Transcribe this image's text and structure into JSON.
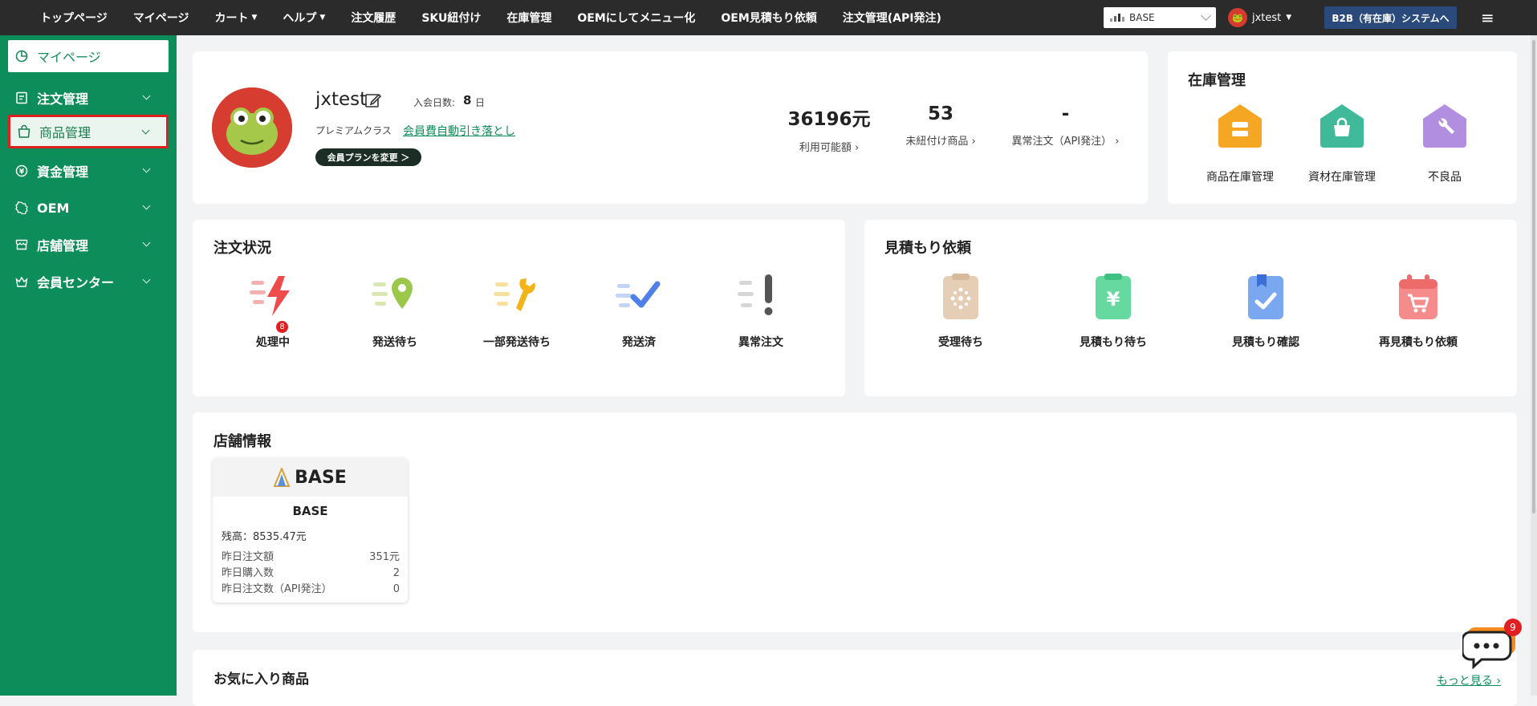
{
  "topnav": {
    "items": [
      {
        "label": "トップページ",
        "caret": false
      },
      {
        "label": "マイページ",
        "caret": false
      },
      {
        "label": "カート",
        "caret": true
      },
      {
        "label": "ヘルプ",
        "caret": true
      },
      {
        "label": "注文履歴",
        "caret": false
      },
      {
        "label": "SKU紐付け",
        "caret": false
      },
      {
        "label": "在庫管理",
        "caret": false
      },
      {
        "label": "OEMにしてメニュー化",
        "caret": false
      },
      {
        "label": "OEM見積もり依頼",
        "caret": false
      },
      {
        "label": "注文管理(API発注)",
        "caret": false
      }
    ],
    "shop_select": "BASE",
    "username": "jxtest",
    "b2b_button": "B2B（有在庫）システムへ",
    "menu_icon": "≡"
  },
  "sidebar": {
    "items": [
      {
        "label": "マイページ",
        "icon": "pie-chart-icon"
      },
      {
        "label": "注文管理",
        "icon": "clipboard-icon"
      },
      {
        "label": "商品管理",
        "icon": "shopping-bag-icon"
      },
      {
        "label": "資金管理",
        "icon": "yen-icon"
      },
      {
        "label": "OEM",
        "icon": "badge-icon"
      },
      {
        "label": "店舗管理",
        "icon": "store-icon"
      },
      {
        "label": "会員センター",
        "icon": "crown-icon"
      }
    ]
  },
  "profile": {
    "name": "jxtest",
    "days_label": "入会日数:",
    "days_value": "8",
    "days_unit": "日",
    "member_class": "プレミアムクラス",
    "member_link": "会員費自動引き落とし",
    "plan_button": "会員プランを変更 ＞",
    "stats": [
      {
        "value": "36196元",
        "label": "利用可能額 ›"
      },
      {
        "value": "53",
        "label": "未紐付け商品 ›"
      },
      {
        "value": "-",
        "label": "異常注文（API発注） ›"
      }
    ]
  },
  "stock": {
    "title": "在庫管理",
    "items": [
      {
        "label": "商品在庫管理",
        "color": "#f5a623"
      },
      {
        "label": "資材在庫管理",
        "color": "#3fb99a"
      },
      {
        "label": "不良品",
        "color": "#b18ee0"
      }
    ]
  },
  "order_status": {
    "title": "注文状況",
    "items": [
      {
        "label": "処理中",
        "badge": "8",
        "color": "#ef4b4b"
      },
      {
        "label": "発送待ち",
        "color": "#9bc74a"
      },
      {
        "label": "一部発送待ち",
        "color": "#f2b418"
      },
      {
        "label": "発送済",
        "color": "#4f7fe8"
      },
      {
        "label": "異常注文",
        "color": "#555555"
      }
    ]
  },
  "quote": {
    "title": "見積もり依頼",
    "items": [
      {
        "label": "受理待ち",
        "color": "#e6cdb6"
      },
      {
        "label": "見積もり待ち",
        "color": "#66d9a0"
      },
      {
        "label": "見積もり確認",
        "color": "#7aa8f0"
      },
      {
        "label": "再見積もり依頼",
        "color": "#f58b8b"
      }
    ]
  },
  "shop_info": {
    "title": "店舗情報",
    "logo_text": "BASE",
    "name": "BASE",
    "balance": "残高：8535.47元",
    "rows": [
      {
        "label": "昨日注文額",
        "value": "351元"
      },
      {
        "label": "昨日購入数",
        "value": "2"
      },
      {
        "label": "昨日注文数（API発注）",
        "value": "0"
      }
    ]
  },
  "favorites": {
    "title": "お気に入り商品",
    "more_link": "もっと見る ›"
  },
  "chat": {
    "badge": "9"
  }
}
